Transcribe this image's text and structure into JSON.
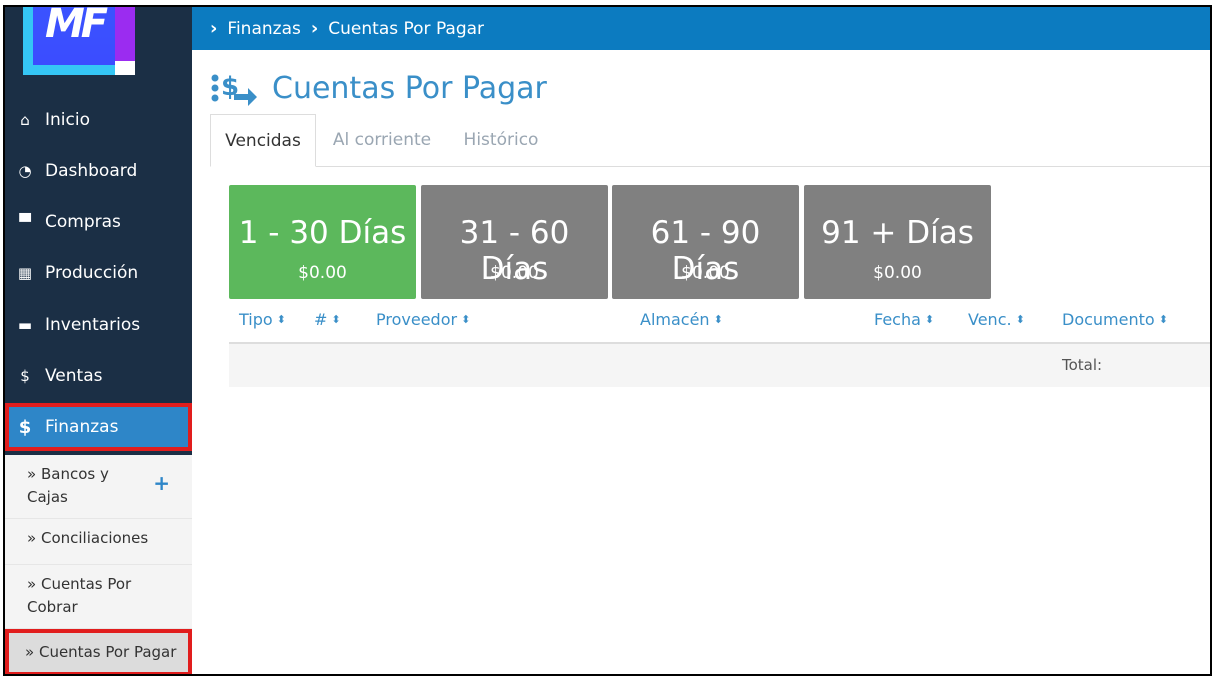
{
  "brand": {
    "logo_text": "MF"
  },
  "sidebar": {
    "items": [
      {
        "label": "Inicio",
        "icon": "home-icon"
      },
      {
        "label": "Dashboard",
        "icon": "dashboard-icon"
      },
      {
        "label": "Compras",
        "icon": "cart-icon"
      },
      {
        "label": "Producción",
        "icon": "factory-icon"
      },
      {
        "label": "Inventarios",
        "icon": "warehouse-icon"
      },
      {
        "label": "Ventas",
        "icon": "sales-icon"
      },
      {
        "label": "Finanzas",
        "icon": "dollar-icon"
      }
    ],
    "subitems": [
      {
        "label": "Bancos y Cajas"
      },
      {
        "label": "Conciliaciones"
      },
      {
        "label": "Cuentas Por Cobrar"
      },
      {
        "label": "Cuentas Por Pagar"
      }
    ],
    "sub_prefix": "»"
  },
  "breadcrumb": {
    "items": [
      "Finanzas",
      "Cuentas Por Pagar"
    ]
  },
  "page": {
    "title": "Cuentas Por Pagar"
  },
  "tabs": [
    {
      "label": "Vencidas"
    },
    {
      "label": "Al corriente"
    },
    {
      "label": "Histórico"
    }
  ],
  "cards": [
    {
      "days": "1 - 30 Días",
      "amount": "$0.00",
      "color": "#5cb85c"
    },
    {
      "days": "31 - 60 Días",
      "amount": "$0.00",
      "color": "#808080"
    },
    {
      "days": "61 - 90 Días",
      "amount": "$0.00",
      "color": "#808080"
    },
    {
      "days": "91 + Días",
      "amount": "$0.00",
      "color": "#808080"
    }
  ],
  "table": {
    "columns": [
      "Tipo",
      "#",
      "Proveedor",
      "Almacén",
      "Fecha",
      "Venc.",
      "Documento"
    ],
    "total_label": "Total:"
  },
  "colors": {
    "sidebar": "#1b2f45",
    "topbar": "#0c7bc0",
    "accent": "#3a8fc8",
    "highlight": "#e11d1d"
  }
}
